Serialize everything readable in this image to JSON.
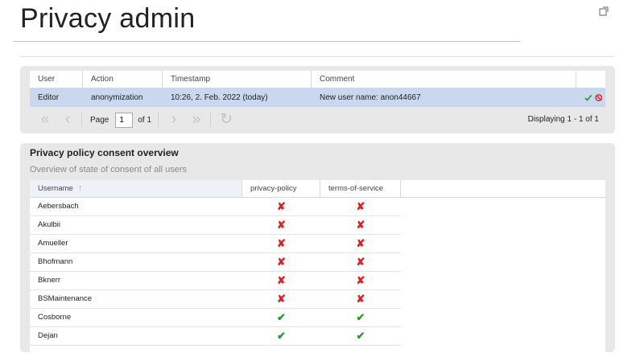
{
  "page": {
    "title": "Privacy admin"
  },
  "log_grid": {
    "columns": [
      "User",
      "Action",
      "Timestamp",
      "Comment"
    ],
    "rows": [
      {
        "user": "Editor",
        "action": "anonymization",
        "timestamp": "10:26, 2. Feb. 2022 (today)",
        "comment": "New user name: anon44667"
      }
    ],
    "pager": {
      "page_label": "Page",
      "page_value": "1",
      "of_label": "of 1",
      "display_text": "Displaying 1 - 1 of 1"
    }
  },
  "consent": {
    "title": "Privacy policy consent overview",
    "subtitle": "Overview of state of consent of all users",
    "columns": [
      "Username",
      "privacy-policy",
      "terms-of-service"
    ],
    "rows": [
      {
        "username": "Aebersbach",
        "privacy_policy": "✘",
        "terms_of_service": "✘"
      },
      {
        "username": "Akulbii",
        "privacy_policy": "✘",
        "terms_of_service": "✘"
      },
      {
        "username": "Amueller",
        "privacy_policy": "✘",
        "terms_of_service": "✘"
      },
      {
        "username": "Bhofmann",
        "privacy_policy": "✘",
        "terms_of_service": "✘"
      },
      {
        "username": "Bknerr",
        "privacy_policy": "✘",
        "terms_of_service": "✘"
      },
      {
        "username": "BSMaintenance",
        "privacy_policy": "✘",
        "terms_of_service": "✘"
      },
      {
        "username": "Cosborne",
        "privacy_policy": "✔",
        "terms_of_service": "✔"
      },
      {
        "username": "Dejan",
        "privacy_policy": "✔",
        "terms_of_service": "✔"
      }
    ]
  }
}
